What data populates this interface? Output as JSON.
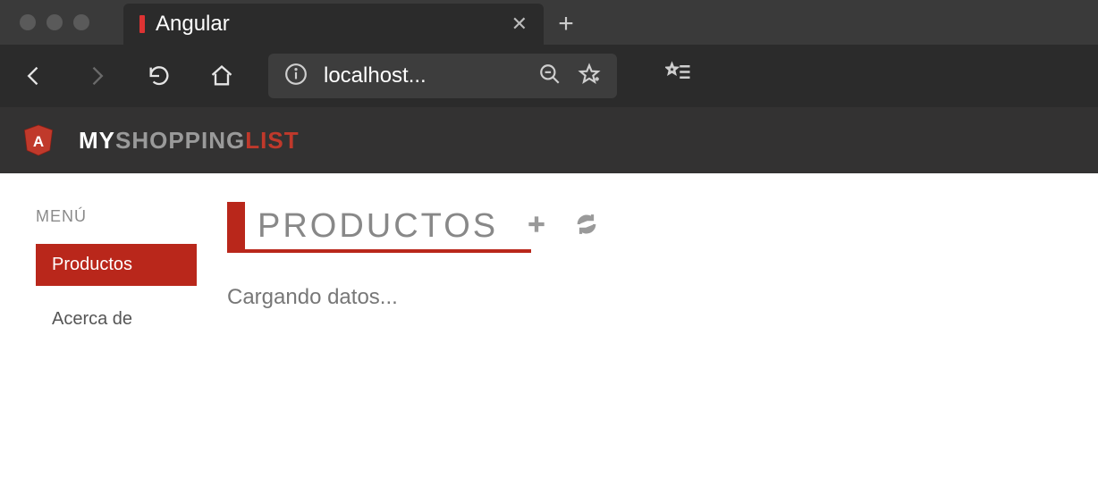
{
  "browser": {
    "tab_title": "Angular",
    "url_display": "localhost..."
  },
  "header": {
    "brand_part1": "MY",
    "brand_part2": "SHOPPING",
    "brand_part3": "LIST"
  },
  "sidebar": {
    "label": "MENÚ",
    "items": [
      {
        "label": "Productos",
        "active": true
      },
      {
        "label": "Acerca de",
        "active": false
      }
    ]
  },
  "main": {
    "title": "PRODUCTOS",
    "loading_text": "Cargando datos..."
  }
}
